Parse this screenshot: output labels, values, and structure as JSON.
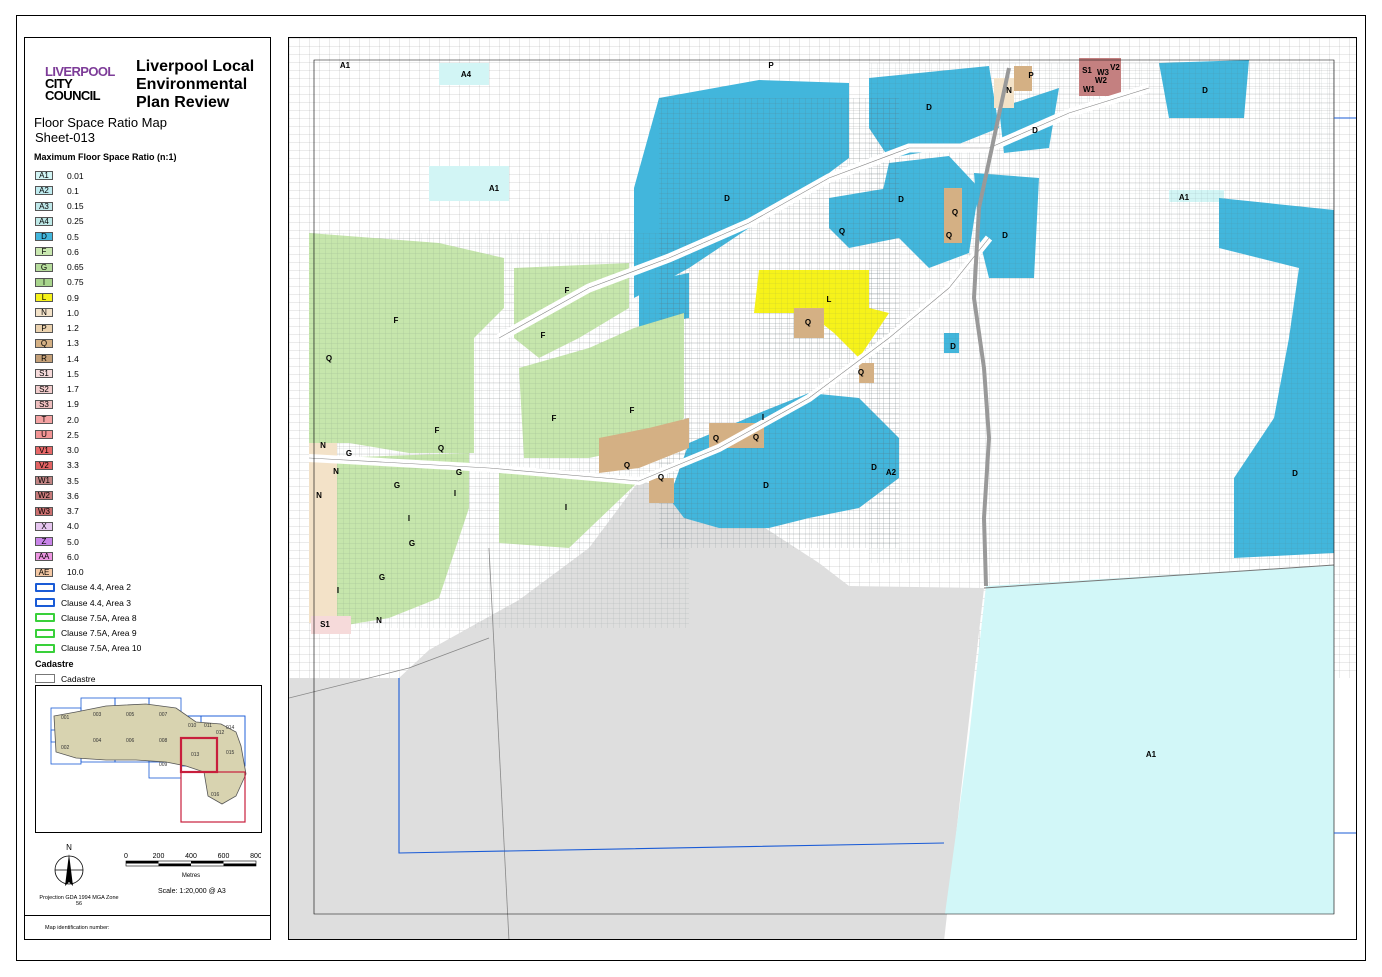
{
  "logo": {
    "line1": "LIVERPOOL",
    "line2": "CITY",
    "line3": "COUNCIL"
  },
  "title": "Liverpool Local Environmental Plan Review",
  "map_name": "Floor Space Ratio Map",
  "sheet": "Sheet-013",
  "legend_title": "Maximum Floor Space Ratio (n:1)",
  "legend": [
    {
      "code": "A1",
      "value": "0.01",
      "color": "#d2f5f5"
    },
    {
      "code": "A2",
      "value": "0.1",
      "color": "#c0ecf0"
    },
    {
      "code": "A3",
      "value": "0.15",
      "color": "#bfe8ea"
    },
    {
      "code": "A4",
      "value": "0.25",
      "color": "#bfeae8"
    },
    {
      "code": "D",
      "value": "0.5",
      "color": "#42b6dc"
    },
    {
      "code": "F",
      "value": "0.6",
      "color": "#c9e8b0"
    },
    {
      "code": "G",
      "value": "0.65",
      "color": "#b6dc9c"
    },
    {
      "code": "I",
      "value": "0.75",
      "color": "#a8d48c"
    },
    {
      "code": "L",
      "value": "0.9",
      "color": "#f6f21a"
    },
    {
      "code": "N",
      "value": "1.0",
      "color": "#f3e2c8"
    },
    {
      "code": "P",
      "value": "1.2",
      "color": "#ebd2ae"
    },
    {
      "code": "Q",
      "value": "1.3",
      "color": "#d4b084"
    },
    {
      "code": "R",
      "value": "1.4",
      "color": "#c4a078"
    },
    {
      "code": "S1",
      "value": "1.5",
      "color": "#f6dada"
    },
    {
      "code": "S2",
      "value": "1.7",
      "color": "#f2cccc"
    },
    {
      "code": "S3",
      "value": "1.9",
      "color": "#eebebe"
    },
    {
      "code": "T",
      "value": "2.0",
      "color": "#f4a2a2"
    },
    {
      "code": "U",
      "value": "2.5",
      "color": "#f29494"
    },
    {
      "code": "V1",
      "value": "3.0",
      "color": "#e86868"
    },
    {
      "code": "V2",
      "value": "3.3",
      "color": "#e26262"
    },
    {
      "code": "W1",
      "value": "3.5",
      "color": "#c28484"
    },
    {
      "code": "W2",
      "value": "3.6",
      "color": "#c87a7a"
    },
    {
      "code": "W3",
      "value": "3.7",
      "color": "#cc7070"
    },
    {
      "code": "X",
      "value": "4.0",
      "color": "#e6c6f0"
    },
    {
      "code": "Z",
      "value": "5.0",
      "color": "#c884e8"
    },
    {
      "code": "AA",
      "value": "6.0",
      "color": "#ee96e2"
    },
    {
      "code": "AE",
      "value": "10.0",
      "color": "#f4c8a4"
    }
  ],
  "clauses": [
    {
      "label": "Clause 4.4, Area 2",
      "color": "#1a5bd6"
    },
    {
      "label": "Clause 4.4, Area 3",
      "color": "#1a5bd6"
    },
    {
      "label": "Clause 7.5A, Area 8",
      "color": "#39d03a"
    },
    {
      "label": "Clause 7.5A, Area 9",
      "color": "#39d03a"
    },
    {
      "label": "Clause 7.5A, Area 10",
      "color": "#39d03a"
    }
  ],
  "cadastre_heading": "Cadastre",
  "cadastre_label": "Cadastre",
  "index_sheets": [
    "001",
    "002",
    "003",
    "004",
    "005",
    "006",
    "007",
    "008",
    "009",
    "010",
    "011",
    "012",
    "013",
    "014",
    "015",
    "016"
  ],
  "scale_ticks": [
    "0",
    "200",
    "400",
    "600",
    "800"
  ],
  "scale_units": "Metres",
  "scale_text": "Scale: 1:20,000 @ A3",
  "north_label": "N",
  "projection": "Projection GDA 1994 MGA Zone 56",
  "map_id": "Map identification number:",
  "map_labels": {
    "a1_top_left": "A1",
    "a4": "A4",
    "a1_mid": "A1",
    "a1_east": "A1",
    "a1_south": "A1",
    "a2": "A2",
    "d": "D",
    "f": "F",
    "g": "G",
    "i": "I",
    "l": "L",
    "n": "N",
    "p": "P",
    "q": "Q",
    "s1": "S1",
    "v2": "V2",
    "w1": "W1",
    "w2": "W2",
    "w3": "W3"
  }
}
